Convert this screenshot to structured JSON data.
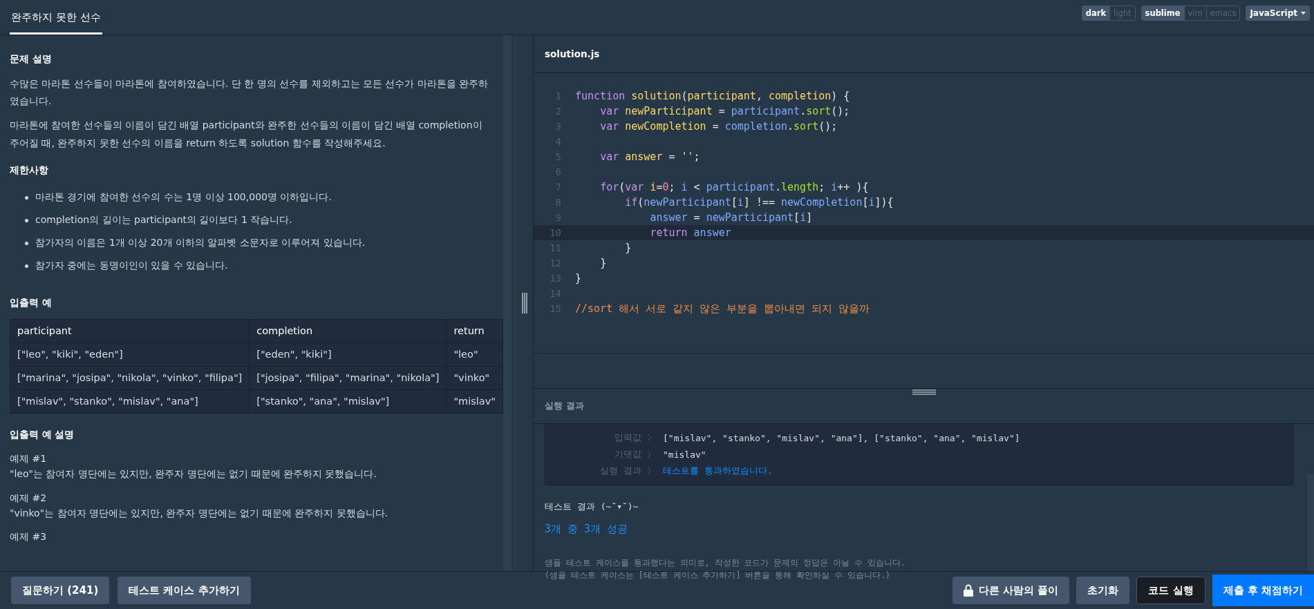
{
  "tabs": [
    {
      "label": "완주하지 못한 선수",
      "selected": true
    }
  ],
  "theme_toggle": [
    {
      "label": "dark",
      "selected": true
    },
    {
      "label": "light",
      "selected": false
    }
  ],
  "keymap_toggle": [
    {
      "label": "sublime",
      "selected": true
    },
    {
      "label": "vim",
      "selected": false
    },
    {
      "label": "emacs",
      "selected": false
    }
  ],
  "language_dropdown": {
    "value": "JavaScript"
  },
  "problem": {
    "sections": [
      {
        "kind": "paragraphs",
        "heading": "문제 설명",
        "items": [
          "수많은 마라톤 선수들이 마라톤에 참여하였습니다. 단 한 명의 선수를 제외하고는 모든 선수가 마라톤을 완주하였습니다.",
          "마라톤에 참여한 선수들의 이름이 담긴 배열 participant와 완주한 선수들의 이름이 담긴 배열 completion이 주어질 때, 완주하지 못한 선수의 이름을 return 하도록 solution 함수를 작성해주세요."
        ]
      },
      {
        "kind": "bullets",
        "heading": "제한사항",
        "items": [
          "마라톤 경기에 참여한 선수의 수는 1명 이상 100,000명 이하입니다.",
          "completion의 길이는 participant의 길이보다 1 작습니다.",
          "참가자의 이름은 1개 이상 20개 이하의 알파벳 소문자로 이루어져 있습니다.",
          "참가자 중에는 동명이인이 있을 수 있습니다."
        ]
      },
      {
        "kind": "table",
        "heading": "입출력 예",
        "columns": [
          "participant",
          "completion",
          "return"
        ],
        "rows": [
          [
            "[\"leo\", \"kiki\", \"eden\"]",
            "[\"eden\", \"kiki\"]",
            "\"leo\""
          ],
          [
            "[\"marina\", \"josipa\", \"nikola\", \"vinko\", \"filipa\"]",
            "[\"josipa\", \"filipa\", \"marina\", \"nikola\"]",
            "\"vinko\""
          ],
          [
            "[\"mislav\", \"stanko\", \"mislav\", \"ana\"]",
            "[\"stanko\", \"ana\", \"mislav\"]",
            "\"mislav\""
          ]
        ]
      },
      {
        "kind": "examples",
        "heading": "입출력 예 설명",
        "items": [
          {
            "title": "예제 #1",
            "text": "\"leo\"는 참여자 명단에는 있지만, 완주자 명단에는 없기 때문에 완주하지 못했습니다."
          },
          {
            "title": "예제 #2",
            "text": "\"vinko\"는 참여자 명단에는 있지만, 완주자 명단에는 없기 때문에 완주하지 못했습니다."
          },
          {
            "title": "예제 #3"
          }
        ]
      }
    ]
  },
  "editor": {
    "filename": "solution.js",
    "lines": [
      {
        "number": "1",
        "active": false,
        "text": "function solution(participant, completion) {"
      },
      {
        "number": "2",
        "active": false,
        "text": "    var newParticipant = participant.sort();"
      },
      {
        "number": "3",
        "active": false,
        "text": "    var newCompletion = completion.sort();"
      },
      {
        "number": "4",
        "active": false
      },
      {
        "number": "5",
        "active": false,
        "text": "    var answer = '';"
      },
      {
        "number": "6",
        "active": false
      },
      {
        "number": "7",
        "active": false,
        "text": "    for(var i=0; i < participant.length; i++ ){"
      },
      {
        "number": "8",
        "active": false,
        "text": "        if(newParticipant[i] !== newCompletion[i]){"
      },
      {
        "number": "9",
        "active": false,
        "text": "            answer = newParticipant[i]"
      },
      {
        "number": "10",
        "active": true,
        "text": "            return answer"
      },
      {
        "number": "11",
        "active": false,
        "text": "        }"
      },
      {
        "number": "12",
        "active": false,
        "text": "    }"
      },
      {
        "number": "13",
        "active": false,
        "text": "}"
      },
      {
        "number": "14",
        "active": false
      },
      {
        "number": "15",
        "active": false,
        "text": "//sort 해서 서로 같지 않은 부분을 뽑아내면 되지 않을까"
      }
    ]
  },
  "results": {
    "heading": "실행 결과",
    "case_rows": [
      {
        "label": "입력값 〉",
        "value": "[\"mislav\", \"stanko\", \"mislav\", \"ana\"], [\"stanko\", \"ana\", \"mislav\"]",
        "passed": false
      },
      {
        "label": "기댓값 〉",
        "value": "\"mislav\"",
        "passed": false
      },
      {
        "label": "실행 결과 〉",
        "value": "테스트를 통과하였습니다.",
        "passed": true
      }
    ],
    "summary_title": "테스트 결과 (~˘▾˘)~",
    "summary": "3개 중 3개 성공",
    "notes": [
      "샘플 테스트 케이스를 통과했다는 의미로, 작성한 코드가 문제의 정답은 아닐 수 있습니다.",
      "(샘플 테스트 케이스는 [테스트 케이스 추가하기] 버튼을 통해 확인하실 수 있습니다.)"
    ]
  },
  "left_buttons": [
    {
      "label": "질문하기 (241)"
    },
    {
      "label": "테스트 케이스 추가하기"
    }
  ],
  "right_buttons": [
    {
      "kind": "locked",
      "label": "다른 사람의 풀이"
    },
    {
      "kind": "plain",
      "label": "초기화"
    },
    {
      "kind": "dark",
      "label": "코드 실행"
    },
    {
      "kind": "primary",
      "label": "제출 후 채점하기"
    }
  ]
}
